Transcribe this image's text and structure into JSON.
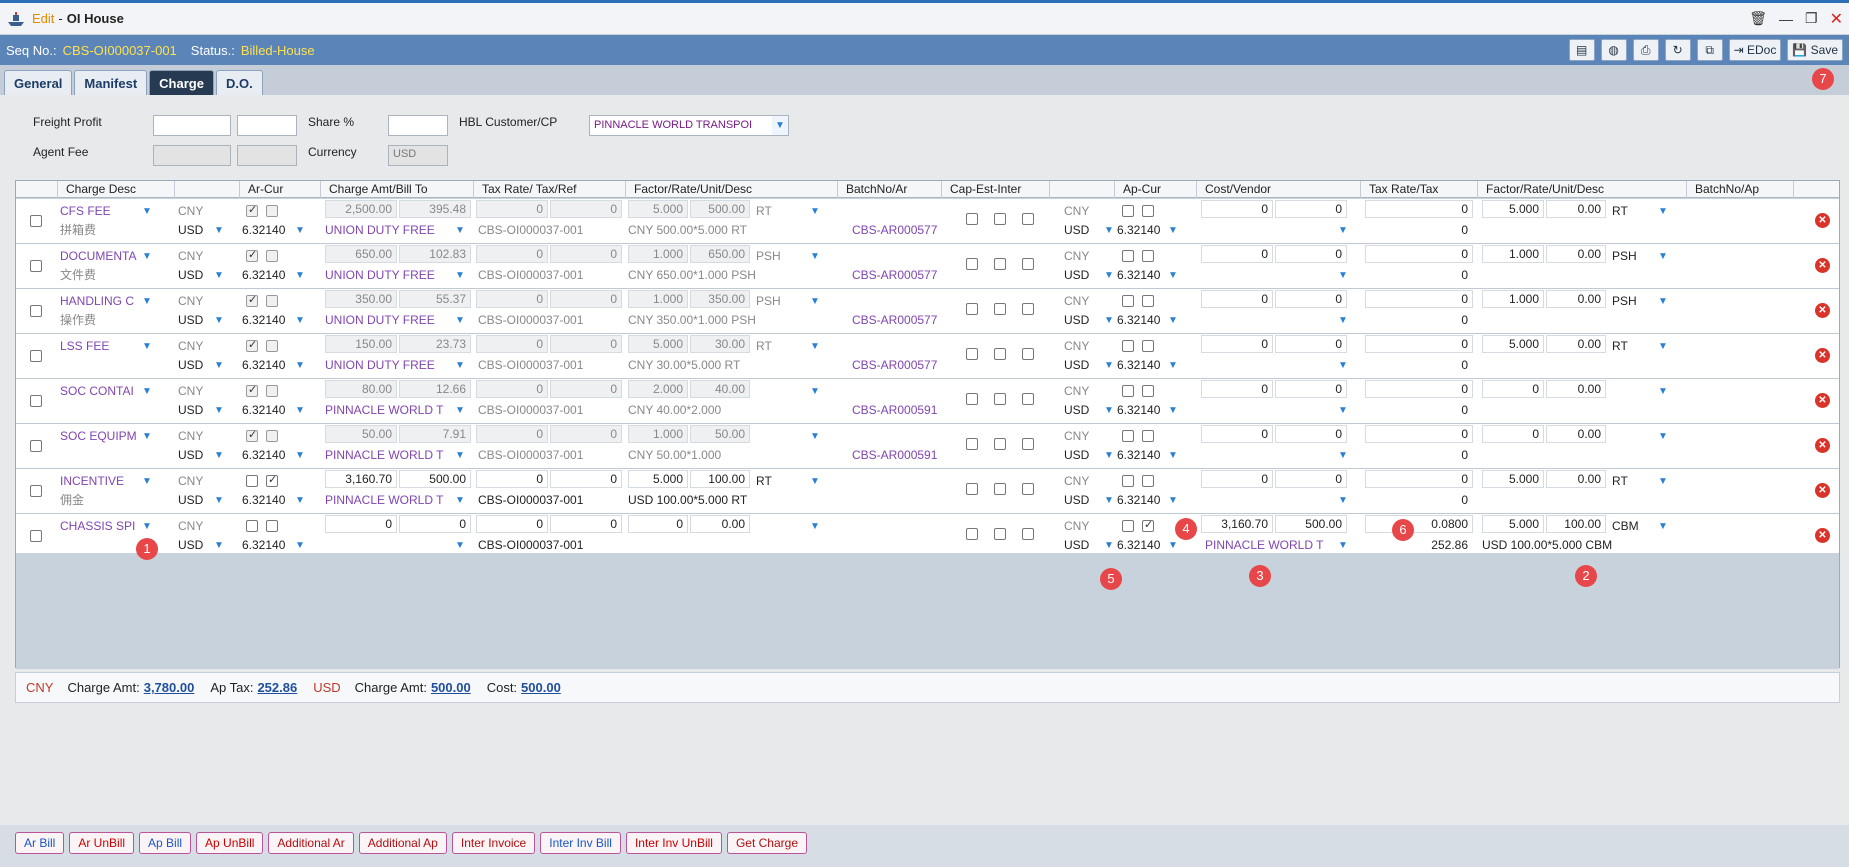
{
  "window": {
    "edit_label": "Edit",
    "separator": "-",
    "title": "OI House"
  },
  "header": {
    "seq_label": "Seq No.:",
    "seq_value": "CBS-OI000037-001",
    "status_label": "Status.:",
    "status_value": "Billed-House",
    "edoc_label": "EDoc",
    "save_label": "Save"
  },
  "tabs": [
    "General",
    "Manifest",
    "Charge",
    "D.O."
  ],
  "form": {
    "freight_profit_label": "Freight Profit",
    "agent_fee_label": "Agent Fee",
    "share_label": "Share %",
    "currency_label": "Currency",
    "currency_value": "USD",
    "hbl_label": "HBL Customer/CP",
    "hbl_value": "PINNACLE WORLD TRANSPOI"
  },
  "columns": [
    "Charge Desc",
    "Ar-Cur",
    "Charge Amt/Bill To",
    "Tax Rate/ Tax/Ref",
    "Factor/Rate/Unit/Desc",
    "BatchNo/Ar",
    "Cap-Est-Inter",
    "Ap-Cur",
    "Cost/Vendor",
    "Tax Rate/Tax",
    "Factor/Rate/Unit/Desc",
    "BatchNo/Ap"
  ],
  "rows": [
    {
      "desc": "CFS FEE",
      "desc2": "拼箱费",
      "arcur": "CNY",
      "arcur2": "USD",
      "rate": "6.32140",
      "amt": "2,500.00",
      "bill": "395.48",
      "billto": "UNION DUTY FREE",
      "taxr": "0",
      "tax": "0",
      "ref": "CBS-OI000037-001",
      "factor": "5.000",
      "frate": "500.00",
      "unit": "RT",
      "fdesc": "CNY 500.00*5.000 RT",
      "batch": "CBS-AR000577",
      "apcur": "CNY",
      "apcur2": "USD",
      "aprate": "6.32140",
      "cost": "0",
      "cost2": "0",
      "vendor": "",
      "aptaxr": "0",
      "aptax": "0",
      "apfactor": "5.000",
      "aprate2": "0.00",
      "apunit": "RT",
      "apdesc": "",
      "editable": false,
      "arcb1": true,
      "arcb2": false,
      "apcb1": false,
      "apcb2": false
    },
    {
      "desc": "DOCUMENTA",
      "desc2": "文件费",
      "arcur": "CNY",
      "arcur2": "USD",
      "rate": "6.32140",
      "amt": "650.00",
      "bill": "102.83",
      "billto": "UNION DUTY FREE",
      "taxr": "0",
      "tax": "0",
      "ref": "CBS-OI000037-001",
      "factor": "1.000",
      "frate": "650.00",
      "unit": "PSH",
      "fdesc": "CNY 650.00*1.000 PSH",
      "batch": "CBS-AR000577",
      "apcur": "CNY",
      "apcur2": "USD",
      "aprate": "6.32140",
      "cost": "0",
      "cost2": "0",
      "vendor": "",
      "aptaxr": "0",
      "aptax": "0",
      "apfactor": "1.000",
      "aprate2": "0.00",
      "apunit": "PSH",
      "apdesc": "",
      "editable": false,
      "arcb1": true,
      "arcb2": false,
      "apcb1": false,
      "apcb2": false
    },
    {
      "desc": "HANDLING C",
      "desc2": "操作费",
      "arcur": "CNY",
      "arcur2": "USD",
      "rate": "6.32140",
      "amt": "350.00",
      "bill": "55.37",
      "billto": "UNION DUTY FREE",
      "taxr": "0",
      "tax": "0",
      "ref": "CBS-OI000037-001",
      "factor": "1.000",
      "frate": "350.00",
      "unit": "PSH",
      "fdesc": "CNY 350.00*1.000 PSH",
      "batch": "CBS-AR000577",
      "apcur": "CNY",
      "apcur2": "USD",
      "aprate": "6.32140",
      "cost": "0",
      "cost2": "0",
      "vendor": "",
      "aptaxr": "0",
      "aptax": "0",
      "apfactor": "1.000",
      "aprate2": "0.00",
      "apunit": "PSH",
      "apdesc": "",
      "editable": false,
      "arcb1": true,
      "arcb2": false,
      "apcb1": false,
      "apcb2": false
    },
    {
      "desc": "LSS FEE",
      "desc2": "",
      "arcur": "CNY",
      "arcur2": "USD",
      "rate": "6.32140",
      "amt": "150.00",
      "bill": "23.73",
      "billto": "UNION DUTY FREE",
      "taxr": "0",
      "tax": "0",
      "ref": "CBS-OI000037-001",
      "factor": "5.000",
      "frate": "30.00",
      "unit": "RT",
      "fdesc": "CNY 30.00*5.000 RT",
      "batch": "CBS-AR000577",
      "apcur": "CNY",
      "apcur2": "USD",
      "aprate": "6.32140",
      "cost": "0",
      "cost2": "0",
      "vendor": "",
      "aptaxr": "0",
      "aptax": "0",
      "apfactor": "5.000",
      "aprate2": "0.00",
      "apunit": "RT",
      "apdesc": "",
      "editable": false,
      "arcb1": true,
      "arcb2": false,
      "apcb1": false,
      "apcb2": false
    },
    {
      "desc": "SOC CONTAI",
      "desc2": "",
      "arcur": "CNY",
      "arcur2": "USD",
      "rate": "6.32140",
      "amt": "80.00",
      "bill": "12.66",
      "billto": "PINNACLE WORLD T",
      "taxr": "0",
      "tax": "0",
      "ref": "CBS-OI000037-001",
      "factor": "2.000",
      "frate": "40.00",
      "unit": "",
      "fdesc": "CNY 40.00*2.000",
      "batch": "CBS-AR000591",
      "apcur": "CNY",
      "apcur2": "USD",
      "aprate": "6.32140",
      "cost": "0",
      "cost2": "0",
      "vendor": "",
      "aptaxr": "0",
      "aptax": "0",
      "apfactor": "0",
      "aprate2": "0.00",
      "apunit": "",
      "apdesc": "",
      "editable": false,
      "arcb1": true,
      "arcb2": false,
      "apcb1": false,
      "apcb2": false
    },
    {
      "desc": "SOC EQUIPM",
      "desc2": "",
      "arcur": "CNY",
      "arcur2": "USD",
      "rate": "6.32140",
      "amt": "50.00",
      "bill": "7.91",
      "billto": "PINNACLE WORLD T",
      "taxr": "0",
      "tax": "0",
      "ref": "CBS-OI000037-001",
      "factor": "1.000",
      "frate": "50.00",
      "unit": "",
      "fdesc": "CNY 50.00*1.000",
      "batch": "CBS-AR000591",
      "apcur": "CNY",
      "apcur2": "USD",
      "aprate": "6.32140",
      "cost": "0",
      "cost2": "0",
      "vendor": "",
      "aptaxr": "0",
      "aptax": "0",
      "apfactor": "0",
      "aprate2": "0.00",
      "apunit": "",
      "apdesc": "",
      "editable": false,
      "arcb1": true,
      "arcb2": false,
      "apcb1": false,
      "apcb2": false
    },
    {
      "desc": "INCENTIVE",
      "desc2": "佣金",
      "arcur": "CNY",
      "arcur2": "USD",
      "rate": "6.32140",
      "amt": "3,160.70",
      "bill": "500.00",
      "billto": "PINNACLE WORLD T",
      "taxr": "0",
      "tax": "0",
      "ref": "CBS-OI000037-001",
      "factor": "5.000",
      "frate": "100.00",
      "unit": "RT",
      "fdesc": "USD 100.00*5.000 RT",
      "batch": "",
      "apcur": "CNY",
      "apcur2": "USD",
      "aprate": "6.32140",
      "cost": "0",
      "cost2": "0",
      "vendor": "",
      "aptaxr": "0",
      "aptax": "0",
      "apfactor": "5.000",
      "aprate2": "0.00",
      "apunit": "RT",
      "apdesc": "",
      "editable": true,
      "arcb1": false,
      "arcb2": true,
      "apcb1": false,
      "apcb2": false
    },
    {
      "desc": "CHASSIS SPI",
      "desc2": "",
      "arcur": "CNY",
      "arcur2": "USD",
      "rate": "6.32140",
      "amt": "0",
      "bill": "0",
      "billto": "",
      "taxr": "0",
      "tax": "0",
      "ref": "CBS-OI000037-001",
      "factor": "0",
      "frate": "0.00",
      "unit": "",
      "fdesc": "",
      "batch": "",
      "apcur": "CNY",
      "apcur2": "USD",
      "aprate": "6.32140",
      "cost": "3,160.70",
      "cost2": "500.00",
      "vendor": "PINNACLE WORLD T",
      "aptaxr": "0.0800",
      "aptax": "252.86",
      "apfactor": "5.000",
      "aprate2": "100.00",
      "apunit": "CBM",
      "apdesc": "USD 100.00*5.000 CBM",
      "editable": true,
      "arcb1": false,
      "arcb2": false,
      "apcb1": false,
      "apcb2": true
    }
  ],
  "totals": {
    "cur1": "CNY",
    "charge_amt_label": "Charge Amt:",
    "charge_amt_cny": "3,780.00",
    "ap_tax_label": "Ap Tax:",
    "ap_tax_cny": "252.86",
    "cur2": "USD",
    "charge_amt_usd": "500.00",
    "cost_label": "Cost:",
    "cost_usd": "500.00"
  },
  "buttons": [
    "Ar Bill",
    "Ar UnBill",
    "Ap Bill",
    "Ap UnBill",
    "Additional Ar",
    "Additional Ap",
    "Inter Invoice",
    "Inter Inv Bill",
    "Inter Inv UnBill",
    "Get Charge"
  ],
  "badges": [
    "1",
    "2",
    "3",
    "4",
    "5",
    "6",
    "7"
  ],
  "colors": {
    "accent": "#5b84b8",
    "status": "#ffe14d",
    "link_purple": "#8046b0",
    "delete": "#d9332a",
    "badge": "#e8474a"
  }
}
